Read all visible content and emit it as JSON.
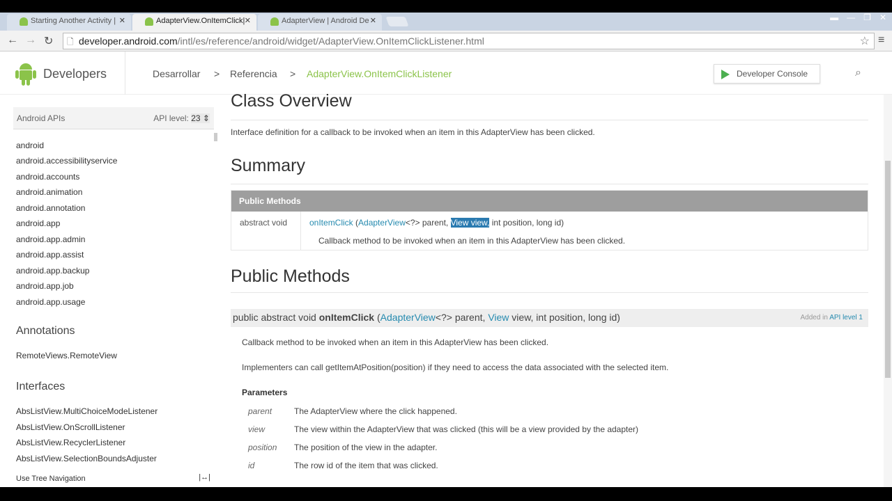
{
  "browser": {
    "tabs": [
      {
        "label": "Starting Another Activity |"
      },
      {
        "label": "AdapterView.OnItemClick|"
      },
      {
        "label": "AdapterView | Android De"
      }
    ],
    "url_host": "developer.android.com",
    "url_path": "/intl/es/reference/android/widget/AdapterView.OnItemClickListener.html"
  },
  "header": {
    "brand": "Developers",
    "crumbs": [
      "Desarrollar",
      "Referencia",
      "AdapterView.OnItemClickListener"
    ],
    "sep": ">",
    "console": "Developer Console"
  },
  "sidebar": {
    "title": "Android APIs",
    "api_label": "API level:",
    "api_value": "23 ⇕",
    "packages": [
      "android",
      "android.accessibilityservice",
      "android.accounts",
      "android.animation",
      "android.annotation",
      "android.app",
      "android.app.admin",
      "android.app.assist",
      "android.app.backup",
      "android.app.job",
      "android.app.usage"
    ],
    "annotations_title": "Annotations",
    "annotations": [
      "RemoteViews.RemoteView"
    ],
    "interfaces_title": "Interfaces",
    "interfaces": [
      "AbsListView.MultiChoiceModeListener",
      "AbsListView.OnScrollListener",
      "AbsListView.RecyclerListener",
      "AbsListView.SelectionBoundsAdjuster"
    ],
    "tree_nav": "Use Tree Navigation"
  },
  "main": {
    "class_overview": "Class Overview",
    "overview_text": "Interface definition for a callback to be invoked when an item in this AdapterView has been clicked.",
    "summary": "Summary",
    "pm_header": "Public Methods",
    "pm_type": "abstract void",
    "pm_method": "onItemClick",
    "pm_paren": " (",
    "pm_adapter": "AdapterView",
    "pm_p1": "<?> parent, ",
    "pm_sel": "View view,",
    "pm_rest": " int position, long id)",
    "pm_desc": "Callback method to be invoked when an item in this AdapterView has been clicked.",
    "public_methods": "Public Methods",
    "sig_prefix": "public abstract void ",
    "sig_method": "onItemClick",
    "sig_open": " (",
    "sig_adapter": "AdapterView",
    "sig_p1": "<?> parent, ",
    "sig_view": "View",
    "sig_rest": " view, int position, long id)",
    "added_in": "Added in ",
    "api_level_link": "API level 1",
    "desc1": "Callback method to be invoked when an item in this AdapterView has been clicked.",
    "desc2": "Implementers can call getItemAtPosition(position) if they need to access the data associated with the selected item.",
    "params_title": "Parameters",
    "params": [
      {
        "name": "parent",
        "desc": "The AdapterView where the click happened."
      },
      {
        "name": "view",
        "desc": "The view within the AdapterView that was clicked (this will be a view provided by the adapter)"
      },
      {
        "name": "position",
        "desc": "The position of the view in the adapter."
      },
      {
        "name": "id",
        "desc": "The row id of the item that was clicked."
      }
    ]
  }
}
